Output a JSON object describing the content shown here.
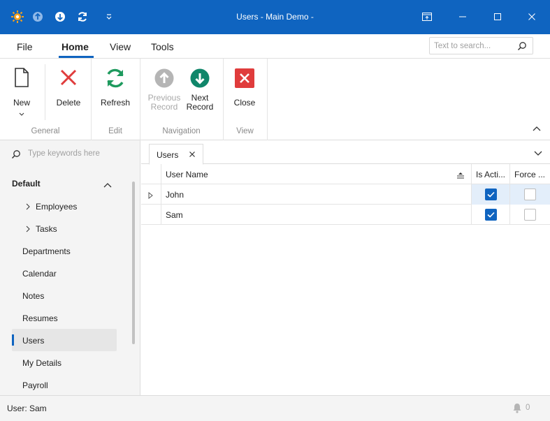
{
  "window": {
    "title": "Users - Main Demo -"
  },
  "ribbon_tabs": [
    {
      "label": "File"
    },
    {
      "label": "Home"
    },
    {
      "label": "View"
    },
    {
      "label": "Tools"
    }
  ],
  "search": {
    "placeholder": "Text to search..."
  },
  "ribbon": {
    "buttons": {
      "new": "New",
      "delete": "Delete",
      "refresh": "Refresh",
      "previous": [
        "Previous",
        "Record"
      ],
      "next": [
        "Next",
        "Record"
      ],
      "close": "Close"
    },
    "groups": {
      "general": "General",
      "edit": "Edit",
      "navigation": "Navigation",
      "view": "View"
    }
  },
  "sidebar": {
    "search_placeholder": "Type keywords here",
    "group": "Default",
    "items": [
      {
        "label": "Employees"
      },
      {
        "label": "Tasks"
      },
      {
        "label": "Departments"
      },
      {
        "label": "Calendar"
      },
      {
        "label": "Notes"
      },
      {
        "label": "Resumes"
      },
      {
        "label": "Users"
      },
      {
        "label": "My Details"
      },
      {
        "label": "Payroll"
      }
    ]
  },
  "document_tab": {
    "label": "Users"
  },
  "grid": {
    "columns": [
      "User Name",
      "Is Acti...",
      "Force ..."
    ],
    "rows": [
      {
        "user_name": "John",
        "is_active": true,
        "force": false
      },
      {
        "user_name": "Sam",
        "is_active": true,
        "force": false
      }
    ]
  },
  "status": {
    "user": "User: Sam",
    "notification_count": "0"
  },
  "colors": {
    "accent": "#0f64c0",
    "delete_red": "#e03c3c",
    "refresh_green": "#1e9a5e",
    "next_green": "#10866a",
    "disabled_gray": "#b5b5b5"
  }
}
